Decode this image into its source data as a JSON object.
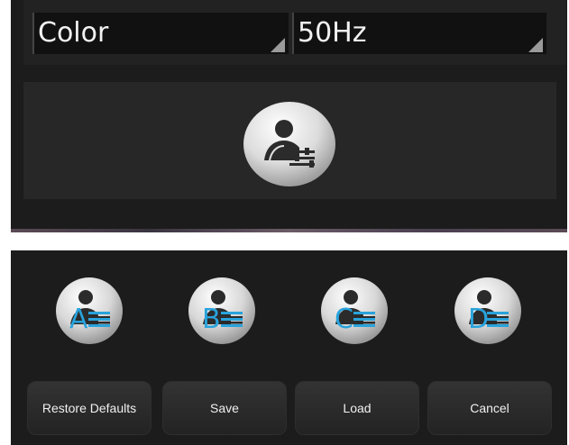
{
  "settings": {
    "color_mode": {
      "value": "Color"
    },
    "frequency": {
      "value": "50Hz"
    }
  },
  "profiles": {
    "main_icon": "user-profile-settings-icon",
    "slots": [
      {
        "letter": "A",
        "icon": "user-profile-icon"
      },
      {
        "letter": "B",
        "icon": "user-profile-icon"
      },
      {
        "letter": "C",
        "icon": "user-profile-icon"
      },
      {
        "letter": "D",
        "icon": "user-profile-icon"
      }
    ]
  },
  "actions": {
    "restore_defaults": "Restore Defaults",
    "save": "Save",
    "load": "Load",
    "cancel": "Cancel"
  },
  "colors": {
    "panel_bg": "#1c1c1c",
    "accent_blue": "#29a3dc",
    "text": "#f0f0f0"
  }
}
